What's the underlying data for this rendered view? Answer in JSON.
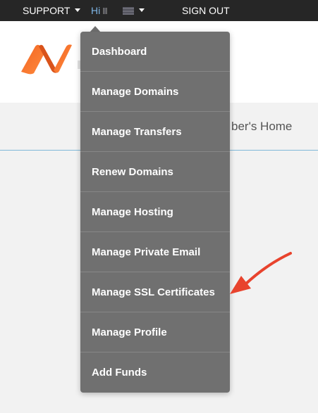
{
  "topbar": {
    "support_label": "SUPPORT",
    "greeting": "Hi",
    "signout_label": "SIGN OUT"
  },
  "main": {
    "home_text_partial": "ber's Home"
  },
  "menu": {
    "items": [
      {
        "label": "Dashboard"
      },
      {
        "label": "Manage Domains"
      },
      {
        "label": "Manage Transfers"
      },
      {
        "label": "Renew Domains"
      },
      {
        "label": "Manage Hosting"
      },
      {
        "label": "Manage Private Email"
      },
      {
        "label": "Manage SSL Certificates"
      },
      {
        "label": "Manage Profile"
      },
      {
        "label": "Add Funds"
      }
    ]
  },
  "colors": {
    "topbar_bg": "#262626",
    "menu_bg": "#707070",
    "menu_divider": "#878787",
    "logo_orange": "#f26522",
    "annotation_red": "#e8432d",
    "greeting_blue": "#7fb6e6",
    "accent_line": "#7fb8d8"
  },
  "icons": {
    "logo": "namecheap-logo-icon",
    "caret": "chevron-down-icon",
    "annotation": "red-arrow-icon"
  }
}
